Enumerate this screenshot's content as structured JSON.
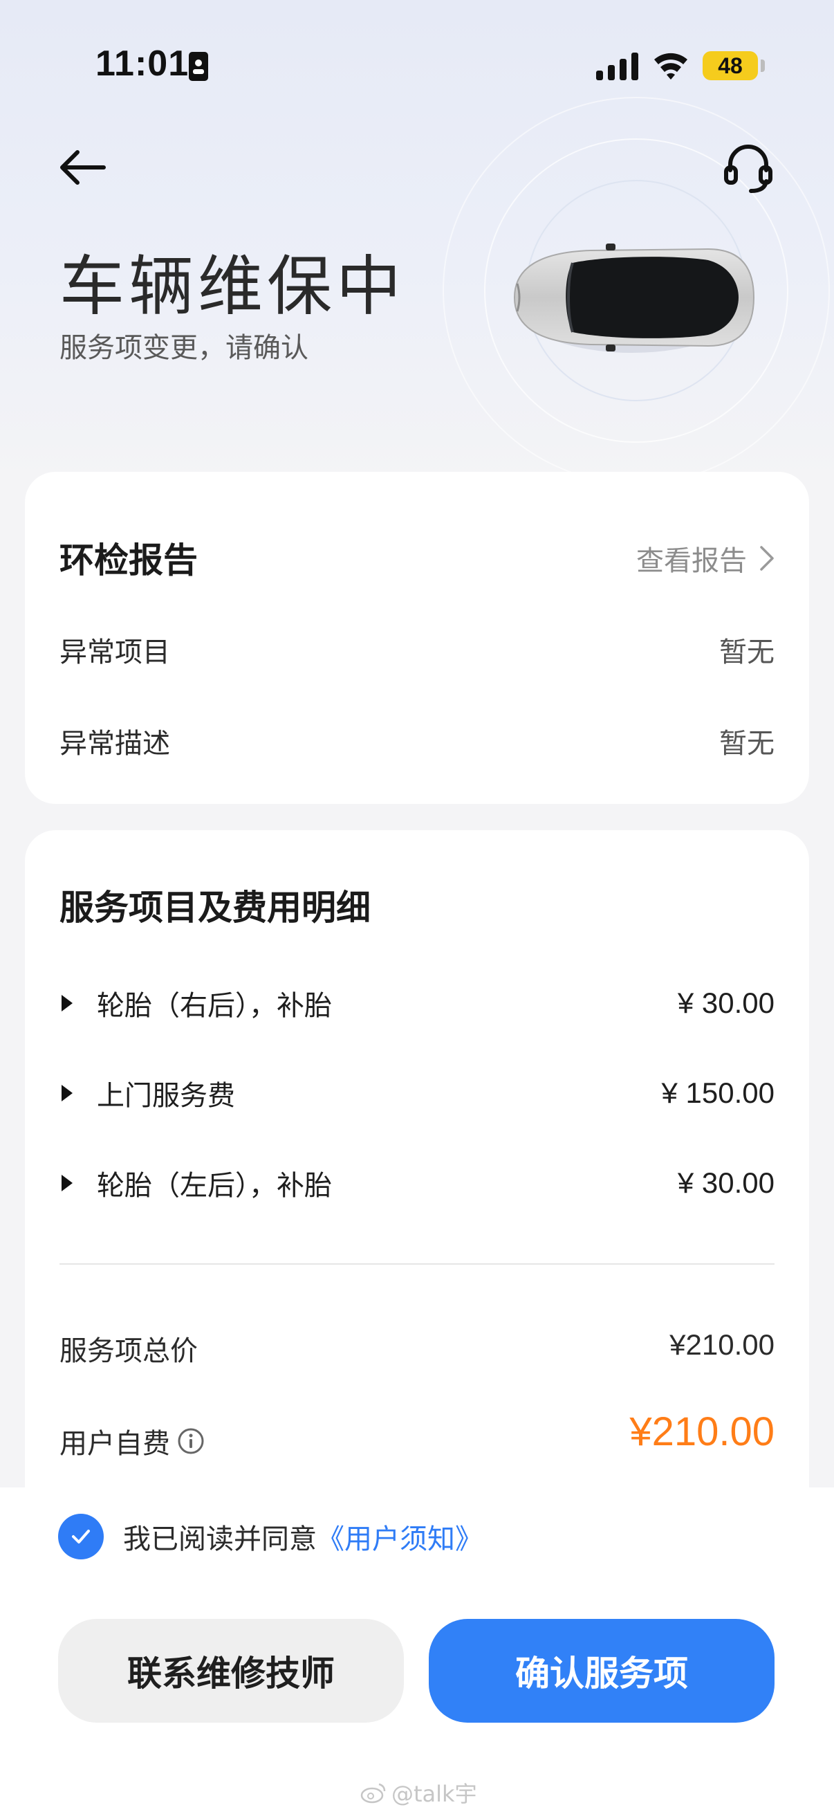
{
  "status_bar": {
    "time": "11:01",
    "battery": "48"
  },
  "header": {
    "title": "车辆维保中",
    "subtitle": "服务项变更，请确认"
  },
  "report_card": {
    "title": "环检报告",
    "link_label": "查看报告",
    "rows": [
      {
        "label": "异常项目",
        "value": "暂无"
      },
      {
        "label": "异常描述",
        "value": "暂无"
      }
    ]
  },
  "service_card": {
    "title": "服务项目及费用明细",
    "items": [
      {
        "label": "轮胎（右后），补胎",
        "price": "¥ 30.00"
      },
      {
        "label": "上门服务费",
        "price": "¥ 150.00"
      },
      {
        "label": "轮胎（左后），补胎",
        "price": "¥ 30.00"
      }
    ],
    "total_label": "服务项总价",
    "total_value": "¥210.00",
    "self_pay_label": "用户自费",
    "self_pay_value": "¥210.00"
  },
  "agreement": {
    "text": "我已阅读并同意",
    "link": "《用户须知》",
    "checked": true
  },
  "buttons": {
    "contact": "联系维修技师",
    "confirm": "确认服务项"
  },
  "watermark": "@talk宇",
  "colors": {
    "accent": "#3181f7",
    "price_highlight": "#ff7d17",
    "battery": "#f5cc1d"
  }
}
